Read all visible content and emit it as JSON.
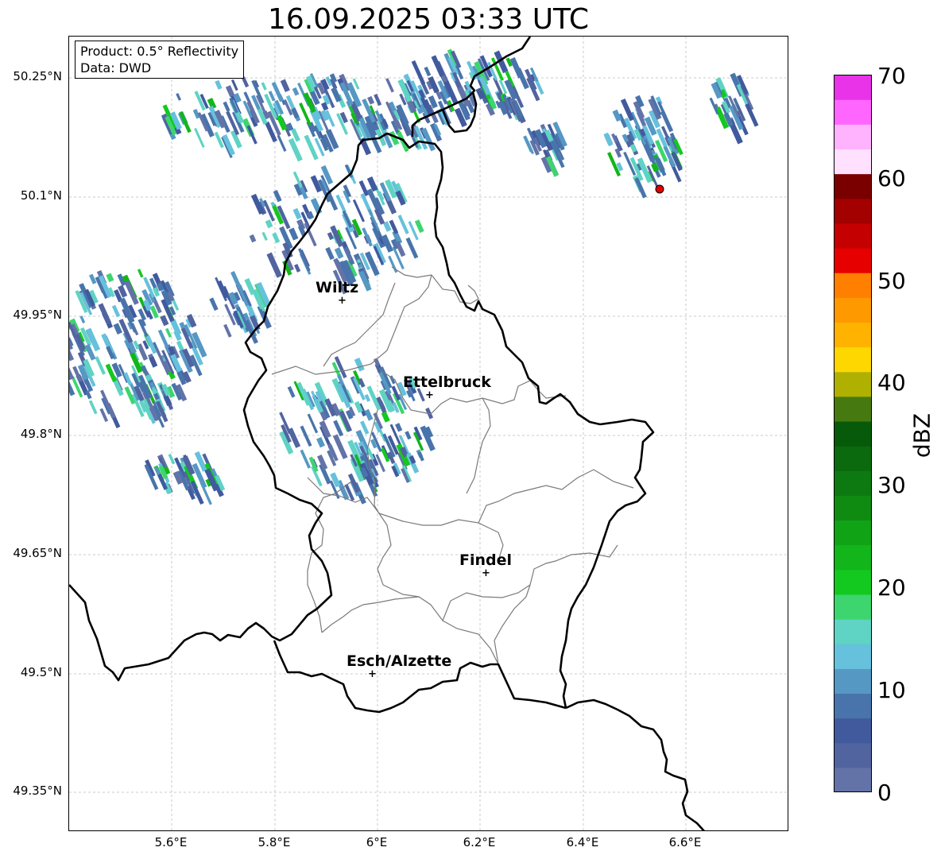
{
  "title": "16.09.2025 03:33 UTC",
  "info_box": {
    "product": "Product: 0.5° Reflectivity",
    "data": "Data: DWD"
  },
  "map": {
    "lat_range": [
      49.3,
      50.3
    ],
    "lon_range": [
      5.4,
      6.8
    ],
    "lat_ticks": [
      "50.25°N",
      "50.1°N",
      "49.95°N",
      "49.8°N",
      "49.65°N",
      "49.5°N",
      "49.35°N"
    ],
    "lon_ticks": [
      "5.6°E",
      "5.8°E",
      "6°E",
      "6.2°E",
      "6.4°E",
      "6.6°E"
    ],
    "grid": true,
    "cities": [
      {
        "name": "Wiltz",
        "marker": "+"
      },
      {
        "name": "Ettelbruck",
        "marker": "+"
      },
      {
        "name": "Findel",
        "marker": "+"
      },
      {
        "name": "Esch/Alzette",
        "marker": "+"
      }
    ],
    "radar_site_color": "#e00000"
  },
  "colorbar": {
    "label": "dBZ",
    "ticks": [
      "0",
      "10",
      "20",
      "30",
      "40",
      "50",
      "60",
      "70"
    ],
    "colors": [
      "#6373a8",
      "#5164a0",
      "#415a9e",
      "#4974ab",
      "#5698c4",
      "#66c1dc",
      "#5fd3c4",
      "#3dd56e",
      "#13c81e",
      "#12b61a",
      "#10a316",
      "#0f8b12",
      "#0c7a10",
      "#0a6a0d",
      "#065a09",
      "#467a10",
      "#b0b000",
      "#ffd700",
      "#ffb300",
      "#ff9900",
      "#ff7f00",
      "#e60000",
      "#c40000",
      "#a30000",
      "#7a0000",
      "#ffe0ff",
      "#ffb3ff",
      "#ff66ff",
      "#e833e8"
    ]
  }
}
